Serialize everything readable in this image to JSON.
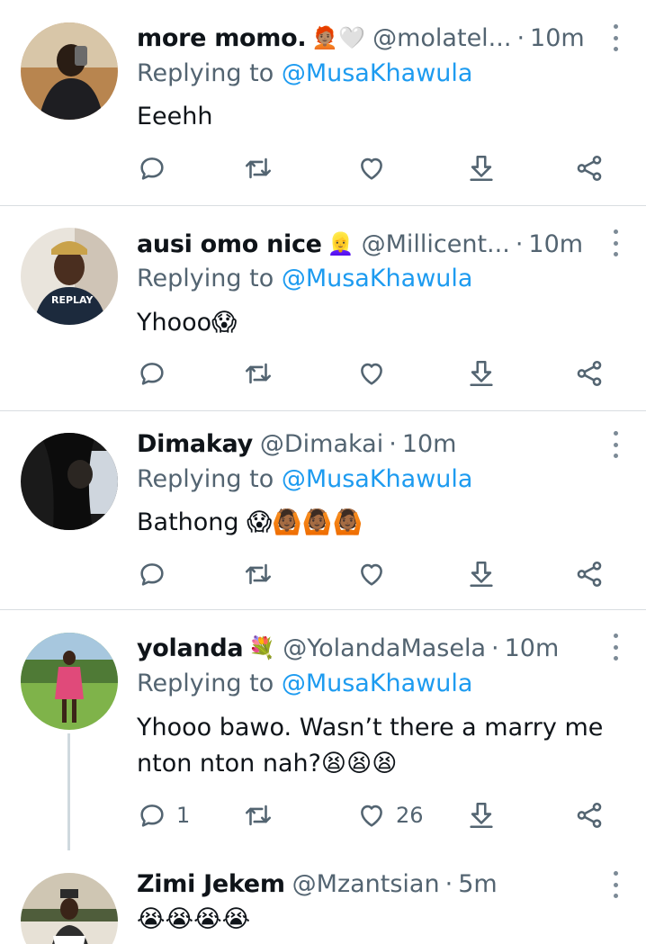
{
  "tweets": [
    {
      "name": "more momo.",
      "badges": "🧑🏽‍🦰🤍",
      "handle": "@molatel...",
      "time": "10m",
      "replying_prefix": "Replying to",
      "replying_to": "@MusaKhawula",
      "text": "Eeehh",
      "reply_count": "",
      "like_count": ""
    },
    {
      "name": "ausi omo nice",
      "badges": "👱‍♀️",
      "handle": "@Millicent...",
      "time": "10m",
      "replying_prefix": "Replying to",
      "replying_to": "@MusaKhawula",
      "text": "Yhooo😱",
      "reply_count": "",
      "like_count": ""
    },
    {
      "name": "Dimakay",
      "badges": "",
      "handle": "@Dimakai",
      "time": "10m",
      "replying_prefix": "Replying to",
      "replying_to": "@MusaKhawula",
      "text": "Bathong 😱🙆🏾🙆🏾🙆🏾",
      "reply_count": "",
      "like_count": ""
    },
    {
      "name": "yolanda",
      "badges": "💐",
      "handle": "@YolandaMasela",
      "time": "10m",
      "replying_prefix": "Replying to",
      "replying_to": "@MusaKhawula",
      "text": "Yhooo bawo. Wasn’t there a marry me nton nton nah?😫😫😫",
      "reply_count": "1",
      "like_count": "26"
    },
    {
      "name": "Zimi Jekem",
      "badges": "",
      "handle": "@Mzantsian",
      "time": "5m",
      "text": "😭😭😭😭"
    }
  ],
  "icons": [
    "reply-icon",
    "retweet-icon",
    "like-icon",
    "download-icon",
    "share-icon",
    "more-icon"
  ],
  "colors": {
    "link": "#1d9bf0",
    "muted": "#536471",
    "divider": "#d9dde1"
  }
}
